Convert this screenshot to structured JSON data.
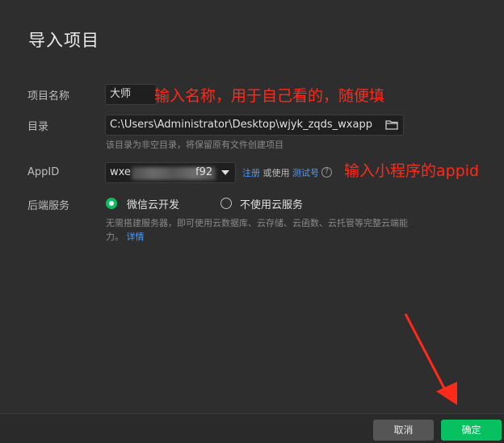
{
  "dialog": {
    "title": "导入项目"
  },
  "form": {
    "name_label": "项目名称",
    "name_value": "大师",
    "dir_label": "目录",
    "dir_value": "C:\\Users\\Administrator\\Desktop\\wjyk_zqds_wxapp",
    "dir_hint": "该目录为非空目录，将保留原有文件创建项目",
    "appid_label": "AppID",
    "appid_prefix": "wxe",
    "appid_suffix": "f92",
    "register_link": "注册",
    "or_use_text": "或使用",
    "test_id_link": "测试号",
    "backend_label": "后端服务",
    "option_cloud": "微信云开发",
    "option_no_cloud": "不使用云服务",
    "cloud_hint": "无需搭建服务器，即可使用云数据库、云存储、云函数、云托管等完整云端能力。",
    "cloud_detail_link": "详情"
  },
  "annotations": {
    "name_note": "输入名称，用于自己看的，随便填",
    "appid_note": "输入小程序的appid",
    "color": "#ff2a1a"
  },
  "footer": {
    "cancel_label": "取消",
    "confirm_label": "确定"
  },
  "colors": {
    "accent": "#07c160",
    "link": "#4a9eff",
    "background": "#2e2e2e"
  },
  "icons": {
    "folder": "folder-icon",
    "dropdown": "caret-down-icon",
    "help": "question-circle-icon"
  }
}
